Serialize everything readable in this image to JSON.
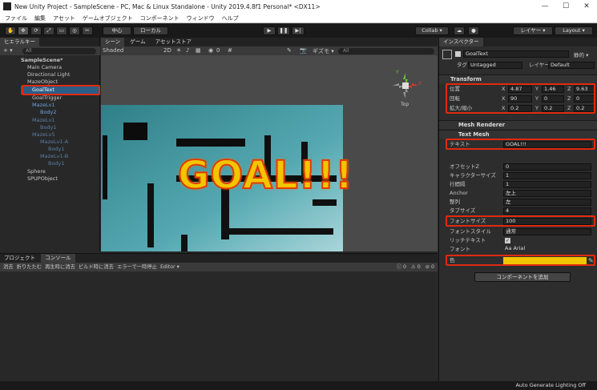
{
  "window": {
    "title": "New Unity Project - SampleScene - PC, Mac & Linux Standalone - Unity 2019.4.8f1 Personal* <DX11>",
    "controls": [
      "—",
      "☐",
      "✕"
    ]
  },
  "menu": [
    "ファイル",
    "編集",
    "アセット",
    "ゲームオブジェクト",
    "コンポーネント",
    "ウィンドウ",
    "ヘルプ"
  ],
  "toolbar": {
    "pivot": "中心",
    "space": "ローカル",
    "collab": "Collab ▾",
    "layers": "レイヤー ▾",
    "layout": "Layout ▾"
  },
  "hierarchy": {
    "tab": "ヒエラルキー",
    "add": "+ ▾",
    "search_placeholder": "All",
    "items": [
      {
        "label": "SampleScene*"
      },
      {
        "label": "Main Camera"
      },
      {
        "label": "Directional Light"
      },
      {
        "label": "MazeObject"
      },
      {
        "label": "GoalText"
      },
      {
        "label": "GoalTrigger"
      },
      {
        "label": "MazeLv1"
      },
      {
        "label": "Body2"
      },
      {
        "label": "MazeLv1"
      },
      {
        "label": "Body1"
      },
      {
        "label": "MazeLv5"
      },
      {
        "label": "MazeLv1-A"
      },
      {
        "label": "Body1"
      },
      {
        "label": "MazeLv1-B"
      },
      {
        "label": "Body1"
      },
      {
        "label": "Sphere"
      },
      {
        "label": "SPUPObject"
      }
    ]
  },
  "scene": {
    "tabs": [
      "シーン",
      "ゲーム",
      "アセットストア"
    ],
    "shading": "Shaded",
    "mode2d": "2D",
    "gizmos": "ギズモ ▾",
    "search_placeholder": "All",
    "layer_count": "0",
    "goal_text": "GOAL!!!",
    "view_label": "Top"
  },
  "console": {
    "tabs": [
      "プロジェクト",
      "コンソール"
    ],
    "buttons": [
      "消去",
      "折りたたむ",
      "再生時に消去",
      "ビルド時に消去",
      "エラーで一時停止",
      "Editor ▾"
    ],
    "counts": [
      "0",
      "0",
      "0"
    ]
  },
  "inspector": {
    "tab": "インスペクター",
    "object_name": "GoalText",
    "static_label": "静的 ▾",
    "tag_label": "タグ",
    "tag": "Untagged",
    "layer_label": "レイヤー",
    "layer": "Default",
    "transform": {
      "title": "Transform",
      "position_label": "位置",
      "position": [
        "4.87",
        "1.46",
        "9.63"
      ],
      "rotation_label": "回転",
      "rotation": [
        "90",
        "0",
        "0"
      ],
      "scale_label": "拡大/縮小",
      "scale": [
        "0.2",
        "0.2",
        "0.2"
      ]
    },
    "mesh_renderer": {
      "title": "Mesh Renderer"
    },
    "text_mesh": {
      "title": "Text Mesh",
      "text_label": "テキスト",
      "text": "GOAL!!!",
      "offset_z_label": "オフセットZ",
      "offset_z": "0",
      "char_size_label": "キャラクターサイズ",
      "char_size": "1",
      "line_spacing_label": "行間隔",
      "line_spacing": "1",
      "anchor_label": "Anchor",
      "anchor": "左上",
      "alignment_label": "整列",
      "alignment": "左",
      "tab_size_label": "タブサイズ",
      "tab_size": "4",
      "font_size_label": "フォントサイズ",
      "font_size": "100",
      "font_style_label": "フォントスタイル",
      "font_style": "通常",
      "rich_text_label": "リッチテキスト",
      "font_label": "フォント",
      "font": "Aa Arial",
      "color_label": "色",
      "color": "#F2C500"
    },
    "add_component": "コンポーネントを追加"
  },
  "status": {
    "right": "Auto Generate Lighting Off"
  },
  "axis_labels": {
    "x": "X",
    "y": "Y",
    "z": "Z"
  },
  "colors": {
    "highlight": "#E02A10",
    "goal_yellow": "#F2C500",
    "maze_teal": "#4FA3AD"
  }
}
